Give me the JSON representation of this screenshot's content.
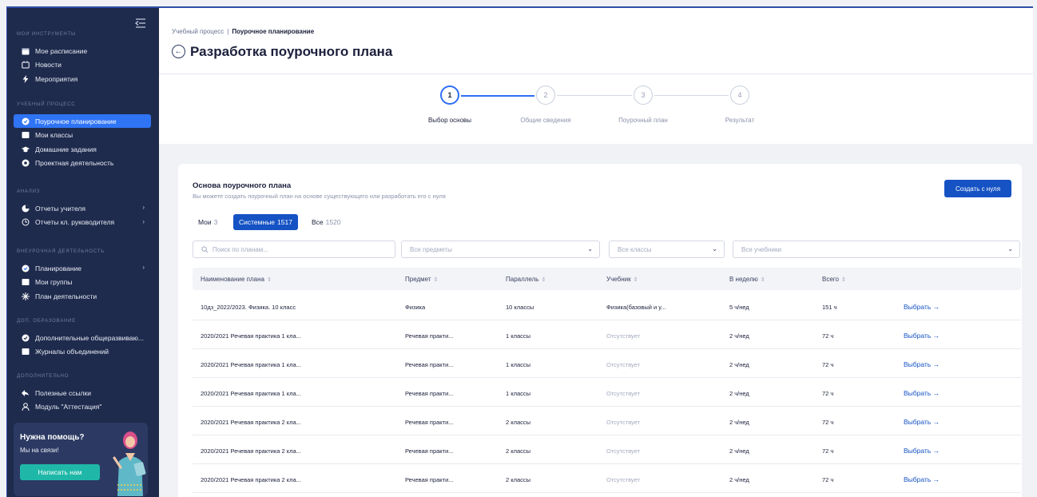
{
  "sidebar": {
    "sections": [
      {
        "title": "Мои инструменты",
        "items": [
          {
            "label": "Мое расписание",
            "icon": "calendar-icon"
          },
          {
            "label": "Новости",
            "icon": "news-icon"
          },
          {
            "label": "Мероприятия",
            "icon": "lightning-icon"
          }
        ]
      },
      {
        "title": "Учебный процесс",
        "items": [
          {
            "label": "Поурочное планирование",
            "icon": "planning-icon",
            "active": true
          },
          {
            "label": "Мои классы",
            "icon": "classes-icon"
          },
          {
            "label": "Домашние задания",
            "icon": "graduation-cap-icon"
          },
          {
            "label": "Проектная деятельность",
            "icon": "project-icon"
          }
        ]
      },
      {
        "title": "Анализ",
        "items": [
          {
            "label": "Отчеты учителя",
            "icon": "pie-chart-icon",
            "has_chevron": true
          },
          {
            "label": "Отчеты кл. руководителя",
            "icon": "clock-report-icon",
            "has_chevron": true
          }
        ]
      },
      {
        "title": "Внеурочная деятельность",
        "items": [
          {
            "label": "Планирование",
            "icon": "planning-icon",
            "has_chevron": true
          },
          {
            "label": "Мои группы",
            "icon": "groups-icon"
          },
          {
            "label": "План деятельности",
            "icon": "sparkle-icon"
          }
        ]
      },
      {
        "title": "Доп. образование",
        "items": [
          {
            "label": "Дополнительные общеразвиваю...",
            "icon": "extra-edu-icon"
          },
          {
            "label": "Журналы объединений",
            "icon": "journal-icon"
          }
        ]
      },
      {
        "title": "Дополнительно",
        "items": [
          {
            "label": "Полезные ссылки",
            "icon": "link-icon"
          },
          {
            "label": "Модуль \"Аттестация\"",
            "icon": "user-icon"
          }
        ]
      }
    ],
    "help": {
      "title": "Нужна помощь?",
      "subtitle": "Мы на связи!",
      "button_label": "Написать нам"
    }
  },
  "breadcrumb": {
    "parent": "Учебный процесс",
    "separator": "|",
    "current": "Поурочное планирование"
  },
  "page_title": "Разработка поурочного плана",
  "stepper": {
    "steps": [
      {
        "number": "1",
        "label": "Выбор основы",
        "active": true
      },
      {
        "number": "2",
        "label": "Общие сведения",
        "active": false
      },
      {
        "number": "3",
        "label": "Поурочный план",
        "active": false
      },
      {
        "number": "4",
        "label": "Результат",
        "active": false
      }
    ]
  },
  "card": {
    "title": "Основа поурочного плана",
    "subtitle": "Вы можете создать поурочный план на основе существующего или разработать его с нуля",
    "create_button": "Создать с нуля",
    "tabs": [
      {
        "label": "Мои",
        "count": "3",
        "active": false
      },
      {
        "label": "Системные",
        "count": "1517",
        "active": true
      },
      {
        "label": "Все",
        "count": "1520",
        "active": false
      }
    ],
    "filters": {
      "search_placeholder": "Поиск по планам...",
      "subject_placeholder": "Все предметы",
      "class_placeholder": "Все классы",
      "textbook_placeholder": "Все учебники"
    },
    "columns": [
      "Наименование плана",
      "Предмет",
      "Параллель",
      "Учебник",
      "В неделю",
      "Всего"
    ],
    "select_label": "Выбрать",
    "rows": [
      {
        "name": "10дз_2022/2023. Физика. 10 класс",
        "subject": "Физика",
        "parallel": "10 классы",
        "textbook": "Физика(базовый и у...",
        "textbook_missing": false,
        "per_week": "5 ч/нед",
        "total": "151 ч"
      },
      {
        "name": "2020/2021 Речевая практика 1 кла...",
        "subject": "Речевая практи...",
        "parallel": "1 классы",
        "textbook": "Отсутствует",
        "textbook_missing": true,
        "per_week": "2 ч/нед",
        "total": "72 ч"
      },
      {
        "name": "2020/2021 Речевая практика 1 кла...",
        "subject": "Речевая практи...",
        "parallel": "1 классы",
        "textbook": "Отсутствует",
        "textbook_missing": true,
        "per_week": "2 ч/нед",
        "total": "72 ч"
      },
      {
        "name": "2020/2021 Речевая практика 1 кла...",
        "subject": "Речевая практи...",
        "parallel": "1 классы",
        "textbook": "Отсутствует",
        "textbook_missing": true,
        "per_week": "2 ч/нед",
        "total": "72 ч"
      },
      {
        "name": "2020/2021 Речевая практика 2 кла...",
        "subject": "Речевая практи...",
        "parallel": "2 классы",
        "textbook": "Отсутствует",
        "textbook_missing": true,
        "per_week": "2 ч/нед",
        "total": "72 ч"
      },
      {
        "name": "2020/2021 Речевая практика 2 кла...",
        "subject": "Речевая практи...",
        "parallel": "2 классы",
        "textbook": "Отсутствует",
        "textbook_missing": true,
        "per_week": "2 ч/нед",
        "total": "72 ч"
      },
      {
        "name": "2020/2021 Речевая практика 2 кла...",
        "subject": "Речевая практи...",
        "parallel": "2 классы",
        "textbook": "Отсутствует",
        "textbook_missing": true,
        "per_week": "2 ч/нед",
        "total": "72 ч"
      }
    ]
  },
  "colors": {
    "sidebar_bg": "#1f2b4d",
    "active_nav": "#2f74f5",
    "primary_button": "#1552c4",
    "help_button": "#1fb8a8",
    "link": "#1552c4"
  }
}
